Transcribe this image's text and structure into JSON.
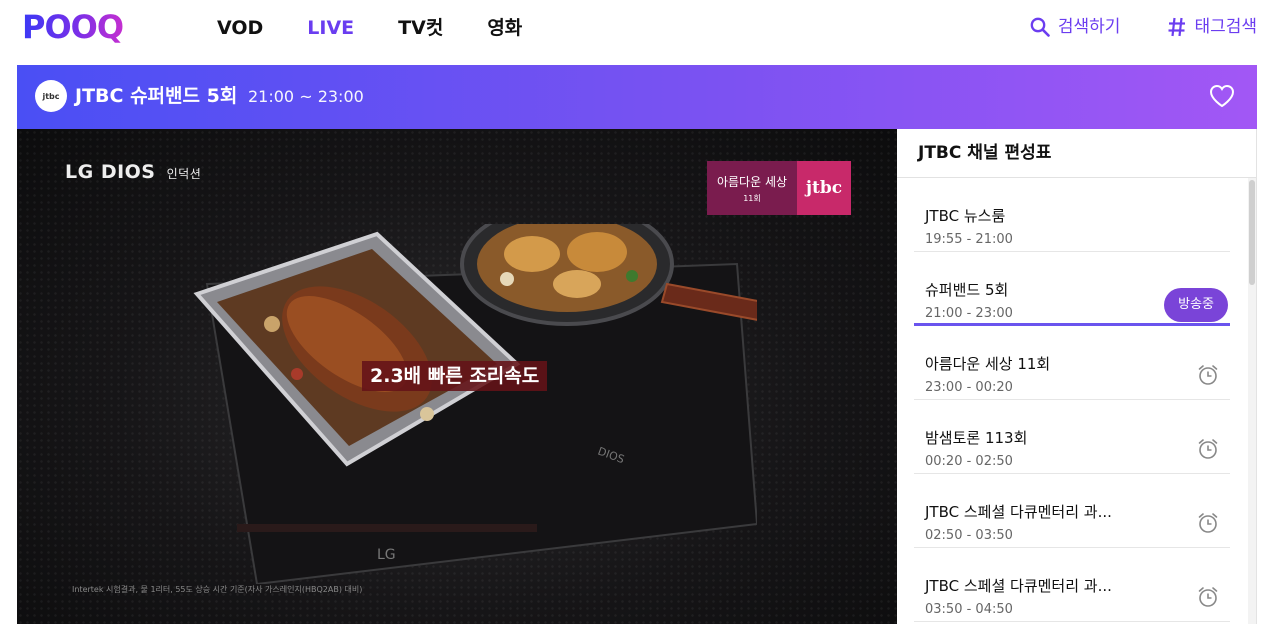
{
  "brand": {
    "logo_text": "POOQ"
  },
  "nav": {
    "links": [
      "VOD",
      "LIVE",
      "TV컷",
      "영화"
    ],
    "active": "LIVE",
    "search_label": "검색하기",
    "tag_search_label": "태그검색"
  },
  "program": {
    "channel_logo_text": "jtbc",
    "title": "JTBC 슈퍼밴드 5회",
    "time": "21:00 ~ 23:00"
  },
  "video": {
    "ad_brand": "LG DIOS",
    "ad_brand_sub": "인덕션",
    "badge_program": "아름다운 세상",
    "badge_episode": "11회",
    "badge_channel": "jtbc",
    "caption": "2.3배 빠른 조리속도",
    "fine_print": "Intertek 시험결과, 물 1리터, 55도 상승 시간 기준(자사 가스레인지(HBQ2AB) 대비)"
  },
  "schedule": {
    "header": "JTBC 채널 편성표",
    "items": [
      {
        "title": "JTBC 뉴스룸",
        "time": "19:55 - 21:00"
      },
      {
        "title": "슈퍼밴드 5회",
        "time": "21:00 - 23:00",
        "badge": "방송중"
      },
      {
        "title": "아름다운 세상 11회",
        "time": "23:00 - 00:20"
      },
      {
        "title": "밤샘토론 113회",
        "time": "00:20 - 02:50"
      },
      {
        "title": "JTBC 스페셜 다큐멘터리 과...",
        "time": "02:50 - 03:50"
      },
      {
        "title": "JTBC 스페셜 다큐멘터리 과...",
        "time": "03:50 - 04:50"
      }
    ]
  },
  "colors": {
    "accent": "#6a3df0",
    "bar_start": "#4a4ff4",
    "bar_end": "#a257f5",
    "onair": "#7a44d8"
  }
}
